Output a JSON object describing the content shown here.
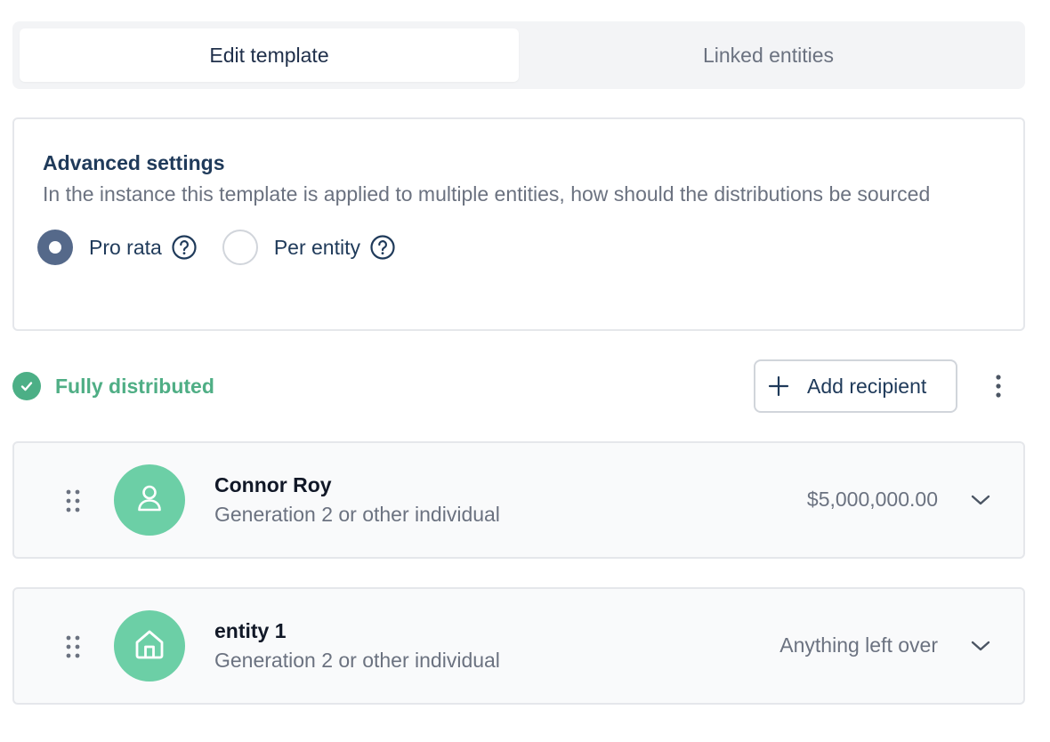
{
  "tabs": [
    {
      "label": "Edit template",
      "active": true
    },
    {
      "label": "Linked entities",
      "active": false
    }
  ],
  "advanced_settings": {
    "title": "Advanced settings",
    "description": "In the instance this template is applied to multiple entities, how should the distributions be sourced",
    "options": [
      {
        "label": "Pro rata",
        "selected": true,
        "icon": "help-circle-icon"
      },
      {
        "label": "Per entity",
        "selected": false,
        "icon": "help-circle-icon"
      }
    ]
  },
  "status": {
    "text": "Fully distributed",
    "icon": "check-circle-icon",
    "color": "#4fae85"
  },
  "actions": {
    "add_recipient_label": "Add recipient",
    "add_icon": "plus-icon",
    "more_icon": "more-vertical-icon"
  },
  "recipients": [
    {
      "name": "Connor Roy",
      "subtitle": "Generation 2 or other individual",
      "amount": "$5,000,000.00",
      "avatar_icon": "user-icon"
    },
    {
      "name": "entity 1",
      "subtitle": "Generation 2 or other individual",
      "amount": "Anything left over",
      "avatar_icon": "home-icon"
    }
  ],
  "colors": {
    "accent_green": "#6ccfa6",
    "radio_selected": "#55698a",
    "primary_text": "#1f3a5a",
    "muted_text": "#6b7280"
  }
}
